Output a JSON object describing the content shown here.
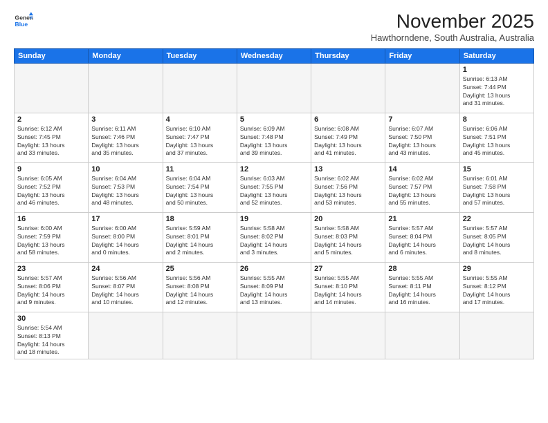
{
  "header": {
    "logo_general": "General",
    "logo_blue": "Blue",
    "month_title": "November 2025",
    "location": "Hawthorndene, South Australia, Australia"
  },
  "weekdays": [
    "Sunday",
    "Monday",
    "Tuesday",
    "Wednesday",
    "Thursday",
    "Friday",
    "Saturday"
  ],
  "weeks": [
    [
      {
        "day": "",
        "info": ""
      },
      {
        "day": "",
        "info": ""
      },
      {
        "day": "",
        "info": ""
      },
      {
        "day": "",
        "info": ""
      },
      {
        "day": "",
        "info": ""
      },
      {
        "day": "",
        "info": ""
      },
      {
        "day": "1",
        "info": "Sunrise: 6:13 AM\nSunset: 7:44 PM\nDaylight: 13 hours\nand 31 minutes."
      }
    ],
    [
      {
        "day": "2",
        "info": "Sunrise: 6:12 AM\nSunset: 7:45 PM\nDaylight: 13 hours\nand 33 minutes."
      },
      {
        "day": "3",
        "info": "Sunrise: 6:11 AM\nSunset: 7:46 PM\nDaylight: 13 hours\nand 35 minutes."
      },
      {
        "day": "4",
        "info": "Sunrise: 6:10 AM\nSunset: 7:47 PM\nDaylight: 13 hours\nand 37 minutes."
      },
      {
        "day": "5",
        "info": "Sunrise: 6:09 AM\nSunset: 7:48 PM\nDaylight: 13 hours\nand 39 minutes."
      },
      {
        "day": "6",
        "info": "Sunrise: 6:08 AM\nSunset: 7:49 PM\nDaylight: 13 hours\nand 41 minutes."
      },
      {
        "day": "7",
        "info": "Sunrise: 6:07 AM\nSunset: 7:50 PM\nDaylight: 13 hours\nand 43 minutes."
      },
      {
        "day": "8",
        "info": "Sunrise: 6:06 AM\nSunset: 7:51 PM\nDaylight: 13 hours\nand 45 minutes."
      }
    ],
    [
      {
        "day": "9",
        "info": "Sunrise: 6:05 AM\nSunset: 7:52 PM\nDaylight: 13 hours\nand 46 minutes."
      },
      {
        "day": "10",
        "info": "Sunrise: 6:04 AM\nSunset: 7:53 PM\nDaylight: 13 hours\nand 48 minutes."
      },
      {
        "day": "11",
        "info": "Sunrise: 6:04 AM\nSunset: 7:54 PM\nDaylight: 13 hours\nand 50 minutes."
      },
      {
        "day": "12",
        "info": "Sunrise: 6:03 AM\nSunset: 7:55 PM\nDaylight: 13 hours\nand 52 minutes."
      },
      {
        "day": "13",
        "info": "Sunrise: 6:02 AM\nSunset: 7:56 PM\nDaylight: 13 hours\nand 53 minutes."
      },
      {
        "day": "14",
        "info": "Sunrise: 6:02 AM\nSunset: 7:57 PM\nDaylight: 13 hours\nand 55 minutes."
      },
      {
        "day": "15",
        "info": "Sunrise: 6:01 AM\nSunset: 7:58 PM\nDaylight: 13 hours\nand 57 minutes."
      }
    ],
    [
      {
        "day": "16",
        "info": "Sunrise: 6:00 AM\nSunset: 7:59 PM\nDaylight: 13 hours\nand 58 minutes."
      },
      {
        "day": "17",
        "info": "Sunrise: 6:00 AM\nSunset: 8:00 PM\nDaylight: 14 hours\nand 0 minutes."
      },
      {
        "day": "18",
        "info": "Sunrise: 5:59 AM\nSunset: 8:01 PM\nDaylight: 14 hours\nand 2 minutes."
      },
      {
        "day": "19",
        "info": "Sunrise: 5:58 AM\nSunset: 8:02 PM\nDaylight: 14 hours\nand 3 minutes."
      },
      {
        "day": "20",
        "info": "Sunrise: 5:58 AM\nSunset: 8:03 PM\nDaylight: 14 hours\nand 5 minutes."
      },
      {
        "day": "21",
        "info": "Sunrise: 5:57 AM\nSunset: 8:04 PM\nDaylight: 14 hours\nand 6 minutes."
      },
      {
        "day": "22",
        "info": "Sunrise: 5:57 AM\nSunset: 8:05 PM\nDaylight: 14 hours\nand 8 minutes."
      }
    ],
    [
      {
        "day": "23",
        "info": "Sunrise: 5:57 AM\nSunset: 8:06 PM\nDaylight: 14 hours\nand 9 minutes."
      },
      {
        "day": "24",
        "info": "Sunrise: 5:56 AM\nSunset: 8:07 PM\nDaylight: 14 hours\nand 10 minutes."
      },
      {
        "day": "25",
        "info": "Sunrise: 5:56 AM\nSunset: 8:08 PM\nDaylight: 14 hours\nand 12 minutes."
      },
      {
        "day": "26",
        "info": "Sunrise: 5:55 AM\nSunset: 8:09 PM\nDaylight: 14 hours\nand 13 minutes."
      },
      {
        "day": "27",
        "info": "Sunrise: 5:55 AM\nSunset: 8:10 PM\nDaylight: 14 hours\nand 14 minutes."
      },
      {
        "day": "28",
        "info": "Sunrise: 5:55 AM\nSunset: 8:11 PM\nDaylight: 14 hours\nand 16 minutes."
      },
      {
        "day": "29",
        "info": "Sunrise: 5:55 AM\nSunset: 8:12 PM\nDaylight: 14 hours\nand 17 minutes."
      }
    ],
    [
      {
        "day": "30",
        "info": "Sunrise: 5:54 AM\nSunset: 8:13 PM\nDaylight: 14 hours\nand 18 minutes."
      },
      {
        "day": "",
        "info": ""
      },
      {
        "day": "",
        "info": ""
      },
      {
        "day": "",
        "info": ""
      },
      {
        "day": "",
        "info": ""
      },
      {
        "day": "",
        "info": ""
      },
      {
        "day": "",
        "info": ""
      }
    ]
  ]
}
